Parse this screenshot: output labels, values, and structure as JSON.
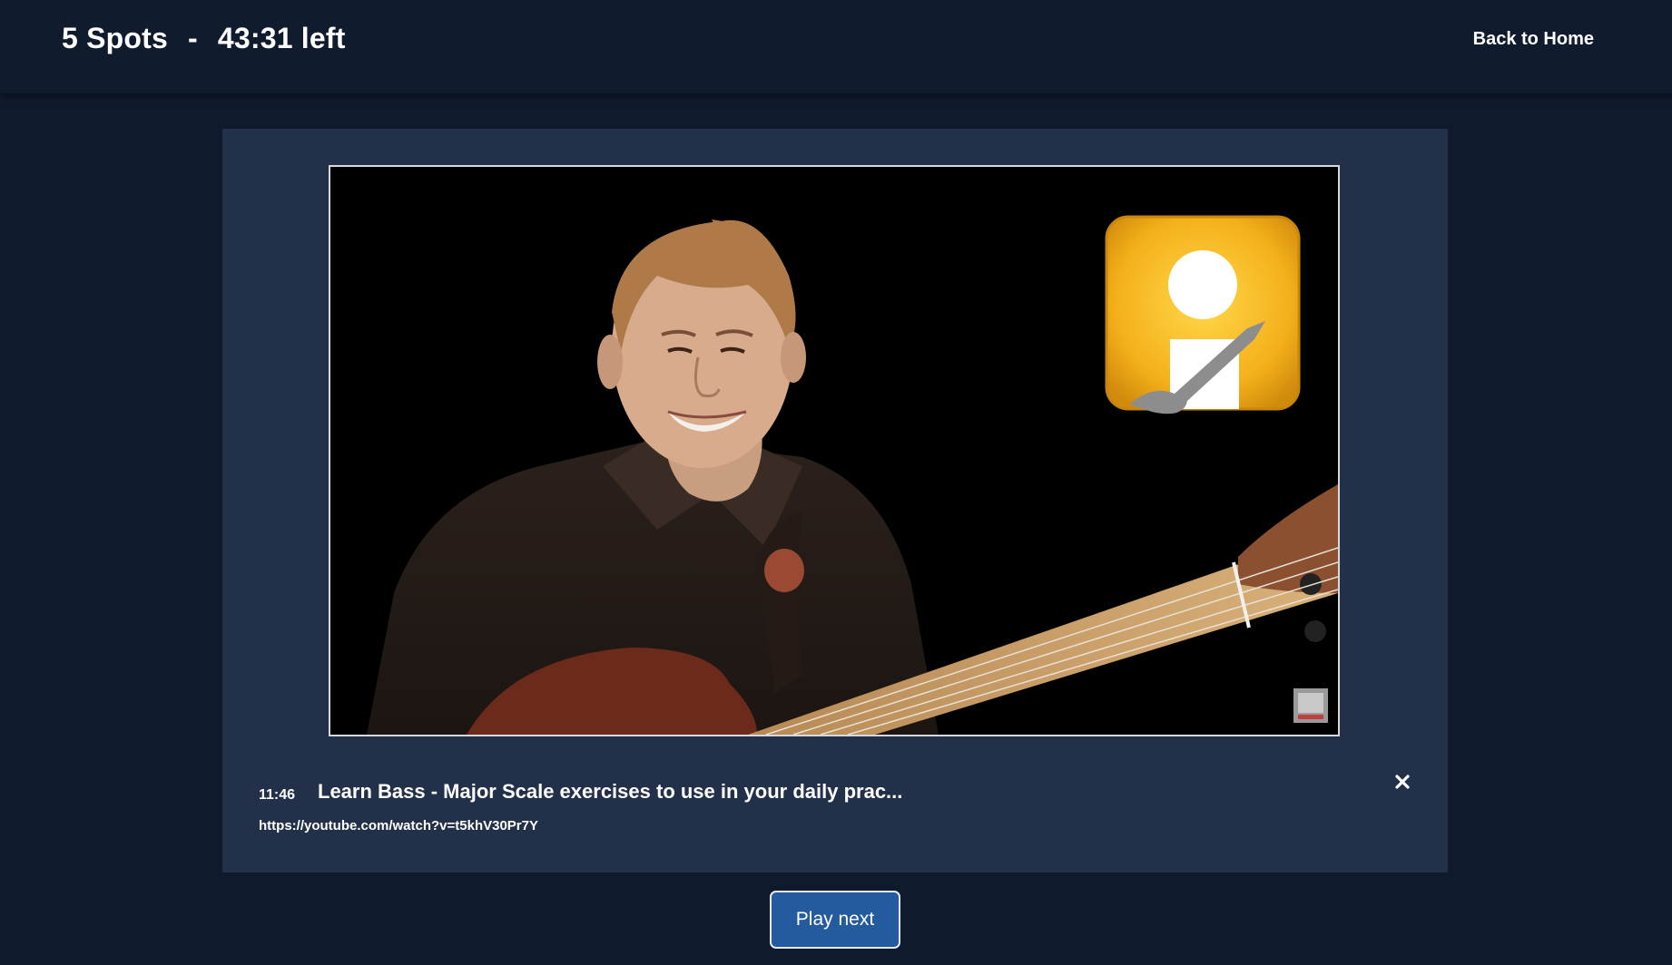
{
  "header": {
    "spots": "5 Spots",
    "separator": "-",
    "time_left": "43:31 left",
    "back_label": "Back to Home"
  },
  "video": {
    "duration": "11:46",
    "title": "Learn Bass - Major Scale exercises to use in your daily prac...",
    "url": "https://youtube.com/watch?v=t5khV30Pr7Y",
    "close_icon": "close-icon"
  },
  "actions": {
    "play_next_label": "Play next"
  },
  "colors": {
    "background": "#0f1a2c",
    "panel": "#22304a",
    "button": "#245a9e",
    "logo": "#f2b21b"
  }
}
